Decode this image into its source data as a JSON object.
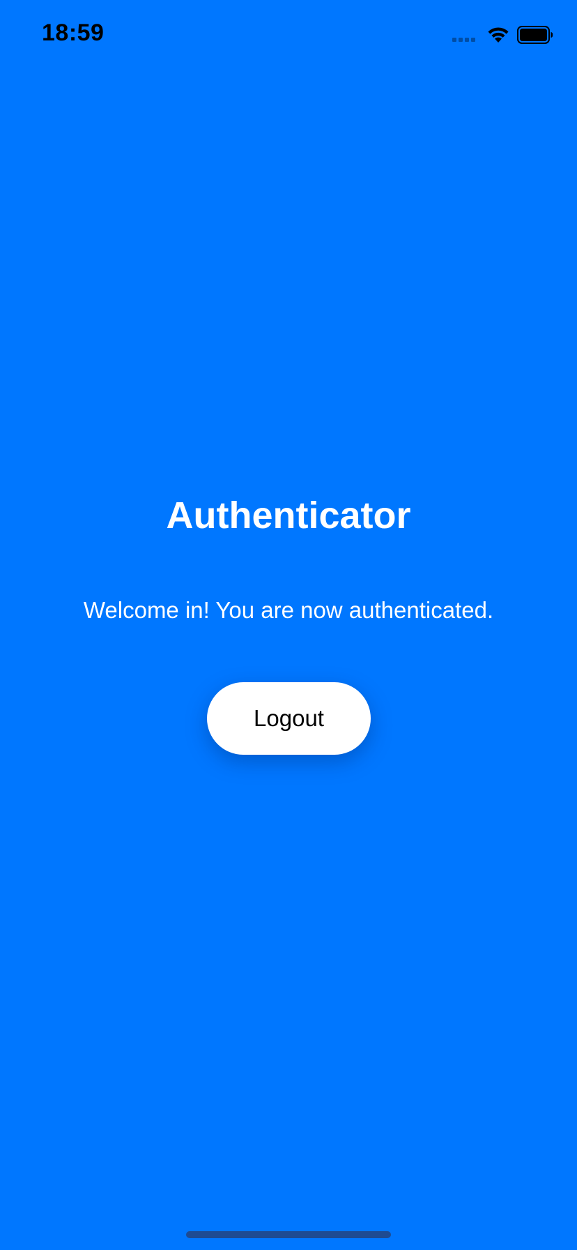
{
  "status_bar": {
    "time": "18:59",
    "icons": [
      "signal-icon",
      "wifi-icon",
      "battery-icon"
    ]
  },
  "main": {
    "title": "Authenticator",
    "welcome_message": "Welcome in! You are now authenticated.",
    "logout_label": "Logout"
  },
  "colors": {
    "background": "#0077FF",
    "button_background": "#FFFFFF",
    "title_text": "#FFFFFF",
    "button_text": "#000000"
  }
}
